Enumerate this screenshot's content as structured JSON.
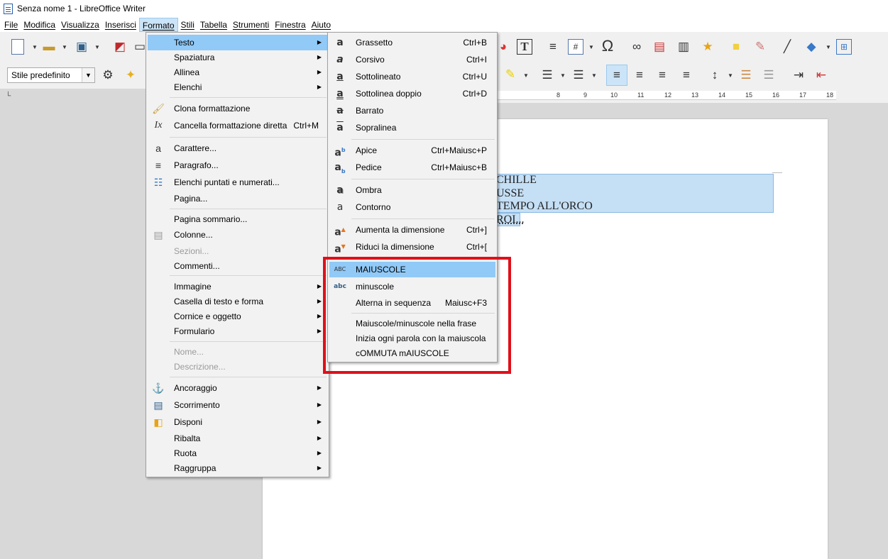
{
  "window": {
    "title": "Senza nome 1 - LibreOffice Writer"
  },
  "menubar": {
    "items": [
      "File",
      "Modifica",
      "Visualizza",
      "Inserisci",
      "Formato",
      "Stili",
      "Tabella",
      "Strumenti",
      "Finestra",
      "Aiuto"
    ],
    "active": "Formato"
  },
  "toolbar": {
    "paragraph_style": "Stile predefinito"
  },
  "ruler": {
    "ticks": [
      "8",
      "9",
      "10",
      "11",
      "12",
      "13",
      "14",
      "15",
      "16",
      "17",
      "18"
    ]
  },
  "document": {
    "lines": [
      "CHILLE",
      "USSE",
      "TEMPO ALL'ORCO",
      "ROI..."
    ]
  },
  "formato_menu": {
    "items": [
      {
        "label": "Testo",
        "submenu": true,
        "selected": true
      },
      {
        "label": "Spaziatura",
        "submenu": true
      },
      {
        "label": "Allinea",
        "submenu": true
      },
      {
        "label": "Elenchi",
        "submenu": true
      },
      {
        "label": "Clona formattazione",
        "icon": "paintbrush-icon"
      },
      {
        "label": "Cancella formattazione diretta",
        "shortcut": "Ctrl+M",
        "icon": "clear-format-icon"
      },
      {
        "label": "Carattere...",
        "icon": "character-icon"
      },
      {
        "label": "Paragrafo...",
        "icon": "paragraph-icon"
      },
      {
        "label": "Elenchi puntati e numerati...",
        "icon": "bullets-icon"
      },
      {
        "label": "Pagina..."
      },
      {
        "label": "Pagina sommario..."
      },
      {
        "label": "Colonne...",
        "icon": "columns-icon"
      },
      {
        "label": "Sezioni...",
        "disabled": true
      },
      {
        "label": "Commenti..."
      },
      {
        "label": "Immagine",
        "submenu": true
      },
      {
        "label": "Casella di testo e forma",
        "submenu": true
      },
      {
        "label": "Cornice e oggetto",
        "submenu": true
      },
      {
        "label": "Formulario",
        "submenu": true
      },
      {
        "label": "Nome...",
        "disabled": true
      },
      {
        "label": "Descrizione...",
        "disabled": true
      },
      {
        "label": "Ancoraggio",
        "submenu": true,
        "icon": "anchor-icon"
      },
      {
        "label": "Scorrimento",
        "submenu": true,
        "icon": "wrap-icon"
      },
      {
        "label": "Disponi",
        "submenu": true,
        "icon": "arrange-icon"
      },
      {
        "label": "Ribalta",
        "submenu": true
      },
      {
        "label": "Ruota",
        "submenu": true
      },
      {
        "label": "Raggruppa",
        "submenu": true
      }
    ]
  },
  "testo_submenu": {
    "items": [
      {
        "label": "Grassetto",
        "shortcut": "Ctrl+B"
      },
      {
        "label": "Corsivo",
        "shortcut": "Ctrl+I"
      },
      {
        "label": "Sottolineato",
        "shortcut": "Ctrl+U"
      },
      {
        "label": "Sottolinea doppio",
        "shortcut": "Ctrl+D"
      },
      {
        "label": "Barrato"
      },
      {
        "label": "Sopralinea"
      },
      {
        "label": "Apice",
        "shortcut": "Ctrl+Maiusc+P"
      },
      {
        "label": "Pedice",
        "shortcut": "Ctrl+Maiusc+B"
      },
      {
        "label": "Ombra"
      },
      {
        "label": "Contorno"
      },
      {
        "label": "Aumenta la dimensione",
        "shortcut": "Ctrl+]"
      },
      {
        "label": "Riduci la dimensione",
        "shortcut": "Ctrl+["
      },
      {
        "label": "MAIUSCOLE",
        "selected": true
      },
      {
        "label": "minuscole"
      },
      {
        "label": "Alterna in sequenza",
        "shortcut": "Maiusc+F3"
      },
      {
        "label": "Maiuscole/minuscole nella frase"
      },
      {
        "label": "Inizia ogni parola con la maiuscola"
      },
      {
        "label": "cOMMUTA mAIUSCOLE"
      }
    ]
  },
  "colors": {
    "highlight": "#91c9f7",
    "annotation": "#e0101a",
    "selection": "#c5dff5"
  }
}
